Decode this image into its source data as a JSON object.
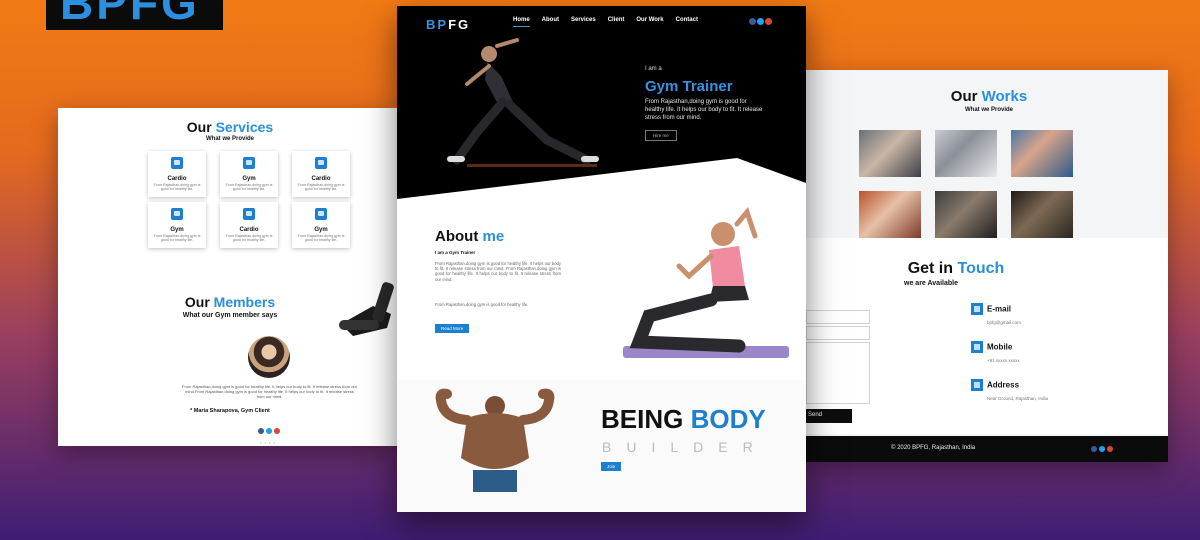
{
  "logo": {
    "text": "BPFG"
  },
  "left_panel": {
    "services_title_a": "Our",
    "services_title_b": "Services",
    "services_subtitle": "What we Provide",
    "services": [
      {
        "title": "Cardio",
        "desc": "From Rajasthan,doing gym is good for healthy life."
      },
      {
        "title": "Gym",
        "desc": "From Rajasthan,doing gym is good for healthy life."
      },
      {
        "title": "Cardio",
        "desc": "From Rajasthan,doing gym is good for healthy life."
      },
      {
        "title": "Gym",
        "desc": "From Rajasthan,doing gym is good for healthy life."
      },
      {
        "title": "Cardio",
        "desc": "From Rajasthan,doing gym is good for healthy life."
      },
      {
        "title": "Gym",
        "desc": "From Rajasthan,doing gym is good for healthy life."
      }
    ],
    "members_title_a": "Our",
    "members_title_b": "Members",
    "members_subtitle": "What our Gym member says",
    "testimonial": "From Rajasthan,doing gym is good for healthy life. It helps our body to fit. It release stress from our mind.From Rajasthan,doing gym is good for healthy life. It helps our body to fit. It release stress from our mind.",
    "member_name": "* Maria Sharapova, Gym Client",
    "pager": "• • • •"
  },
  "center_panel": {
    "brand_a": "BP",
    "brand_b": "FG",
    "nav": [
      "Home",
      "About",
      "Services",
      "Client",
      "Our Work",
      "Contact"
    ],
    "hero_small": "I am a",
    "hero_title": "Gym Trainer",
    "hero_text": "From Rajasthan,doing gym is good for healthy life. It helps our body to fit. It release stress from our mind.",
    "hero_button": "Hire me",
    "about_title_a": "About",
    "about_title_b": "me",
    "about_sub": "I am a Gym Trainer",
    "about_p1": "From Rajasthan,doing gym is good for healthy life. It helps our body to fit. It release stress from our mind. From Rajasthan,doing gym is good for healthy life. It helps our body to fit. It release stress from our mind.",
    "about_p2": "From Rajasthan,doing gym is good for healthy life.",
    "about_button": "Read More",
    "being": "BEING",
    "body": "BODY",
    "builder": "BUILDER",
    "bb_button": "Join"
  },
  "right_panel": {
    "works_title_a": "Our",
    "works_title_b": "Works",
    "works_subtitle": "What we Provide",
    "touch_title_a": "Get in",
    "touch_title_b": "Touch",
    "touch_subtitle": "we are Available",
    "send_button": "Send",
    "email_label": "E-mail",
    "email_value": "bpfg@gmail.com",
    "mobile_label": "Mobile",
    "mobile_value": "+91 xxxxx xxxxx",
    "address_label": "Address",
    "address_value": "Near Ground, Rajasthan, India",
    "footer": "© 2020 BPFG, Rajasthan, India"
  },
  "colors": {
    "accent": "#1d7fd0",
    "facebook": "#3b5998",
    "twitter": "#1da1f2",
    "google": "#d34836"
  }
}
